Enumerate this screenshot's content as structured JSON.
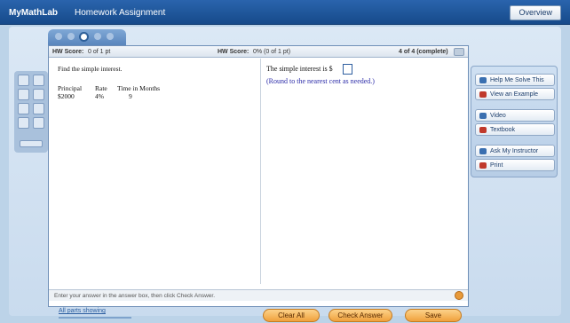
{
  "header": {
    "brand": "MyMathLab",
    "assignment_title": "Homework Assignment",
    "overview_label": "Overview"
  },
  "tabs": {
    "count": 5,
    "active_index": 2
  },
  "panel": {
    "hw_score_label": "HW Score:",
    "hw_score_value": "0 of 1 pt",
    "score_label": "HW Score:",
    "score_value": "0% (0 of 1 pt)",
    "question_of": "4 of 4 (complete)"
  },
  "question": {
    "prompt": "Find the simple interest.",
    "headers": [
      "Principal",
      "Rate",
      "Time in Months"
    ],
    "row": [
      "$2000",
      "4%",
      "9"
    ]
  },
  "answer": {
    "text": "The simple interest is $",
    "round_note": "(Round to the nearest cent as needed.)"
  },
  "status_bar": {
    "text": "Enter your answer in the answer box, then click Check Answer."
  },
  "help": {
    "items": [
      {
        "label": "Help Me Solve This",
        "icon": "help-icon",
        "color": "#3a6fb0"
      },
      {
        "label": "View an Example",
        "icon": "example-icon",
        "color": "#c0392b"
      },
      {
        "label": "Video",
        "icon": "video-icon",
        "color": "#3a6fb0"
      },
      {
        "label": "Textbook",
        "icon": "textbook-icon",
        "color": "#c0392b"
      },
      {
        "label": "Ask My Instructor",
        "icon": "ask-instructor-icon",
        "color": "#3a6fb0"
      },
      {
        "label": "Print",
        "icon": "print-icon",
        "color": "#c0392b"
      }
    ]
  },
  "footer": {
    "link": "All parts showing",
    "clear_all": "Clear All",
    "check_answer": "Check Answer",
    "save": "Save"
  },
  "colors": {
    "topbar": "#1d5597",
    "accent_orange": "#f0a13c",
    "link_blue": "#2a2aa8"
  }
}
